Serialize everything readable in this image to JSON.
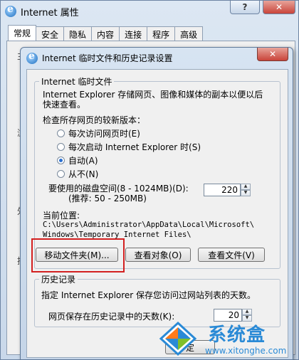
{
  "outer": {
    "title": "Internet 属性",
    "help_label": "?",
    "close_label": "✕",
    "tabs": [
      "常规",
      "安全",
      "隐私",
      "内容",
      "连接",
      "程序",
      "高级"
    ],
    "ghost_labels": [
      "主",
      "浏",
      "外",
      "搜"
    ]
  },
  "dialog": {
    "title": "Internet 临时文件和历史记录设置",
    "close_label": "✕",
    "temp_files": {
      "legend": "Internet 临时文件",
      "desc_line1": "Internet Explorer 存储网页、图像和媒体的副本以便以后",
      "desc_line2": "快速查看。",
      "check_label": "检查所存网页的较新版本：",
      "options": [
        "每次访问网页时(E)",
        "每次启动 Internet Explorer 时(S)",
        "自动(A)",
        "从不(N)"
      ],
      "selected_option": "自动(A)",
      "disk_label": "要使用的磁盘空间(8 - 1024MB)(D):",
      "disk_hint": "(推荐: 50 - 250MB)",
      "disk_value": "220",
      "location_label": "当前位置:",
      "location_line1": "C:\\Users\\Administrator\\AppData\\Local\\Microsoft\\",
      "location_line2": "Windows\\Temporary Internet Files\\",
      "move_button": "移动文件夹(M)...",
      "view_objects_button": "查看对象(O)",
      "view_files_button": "查看文件(V)"
    },
    "history": {
      "legend": "历史记录",
      "desc": "指定 Internet Explorer 保存您访问过网站列表的天数。",
      "days_label": "网页保存在历史记录中的天数(K):",
      "days_value": "20"
    },
    "ok_button_partial": "定"
  },
  "watermark": {
    "brand": "系统盒",
    "url": "www.xitonghe.com"
  },
  "colors": {
    "highlight_border": "#d32020",
    "watermark_blue": "#2a8ad6"
  }
}
